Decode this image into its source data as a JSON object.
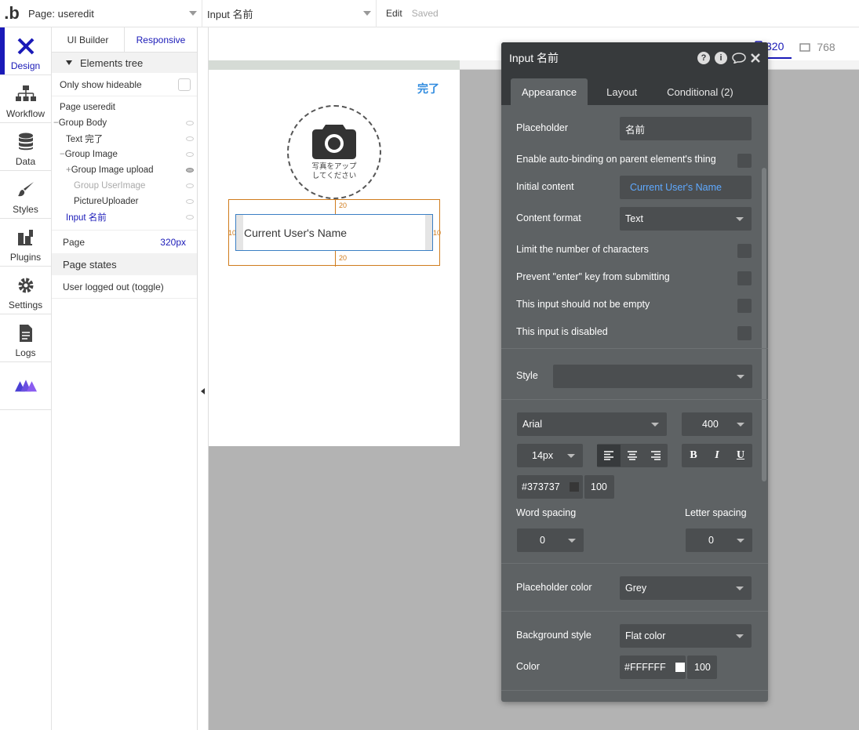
{
  "topbar": {
    "logo": ".b",
    "page_select": "Page: useredit",
    "element_select": "Input 名前",
    "edit": "Edit",
    "saved": "Saved"
  },
  "rail": {
    "items": [
      {
        "label": "Design",
        "icon": "design-icon"
      },
      {
        "label": "Workflow",
        "icon": "workflow-icon"
      },
      {
        "label": "Data",
        "icon": "data-icon"
      },
      {
        "label": "Styles",
        "icon": "styles-icon"
      },
      {
        "label": "Plugins",
        "icon": "plugins-icon"
      },
      {
        "label": "Settings",
        "icon": "settings-icon"
      },
      {
        "label": "Logs",
        "icon": "logs-icon"
      }
    ],
    "accent": "#1a1ab8"
  },
  "panel": {
    "tab_ui": "UI Builder",
    "tab_responsive": "Responsive",
    "elements_tree": "Elements tree",
    "only_show_hideable": "Only show hideable",
    "tree": [
      "Page useredit",
      "Group Body",
      "Text 完了",
      "Group Image",
      "Group Image upload",
      "Group UserImage",
      "PictureUploader",
      "Input 名前"
    ],
    "page_label": "Page",
    "page_value": "320px",
    "page_states": "Page states",
    "state_1": "User logged out (toggle)"
  },
  "canvas": {
    "done": "完了",
    "camera_text_1": "写真をアップ",
    "camera_text_2": "してください",
    "margin_top": "20",
    "margin_bottom": "20",
    "margin_left": "10",
    "margin_right": "10",
    "input_text": "Current User's Name",
    "resp_320": "320",
    "resp_768": "768"
  },
  "editor": {
    "title": "Input 名前",
    "tabs": [
      "Appearance",
      "Layout",
      "Conditional (2)"
    ],
    "placeholder_label": "Placeholder",
    "placeholder_value": "名前",
    "auto_binding": "Enable auto-binding on parent element's thing",
    "initial_content_label": "Initial content",
    "initial_content_value": "Current User's Name",
    "content_format_label": "Content format",
    "content_format_value": "Text",
    "limit_chars": "Limit the number of characters",
    "prevent_enter": "Prevent \"enter\" key from submitting",
    "not_empty": "This input should not be empty",
    "disabled": "This input is disabled",
    "style_label": "Style",
    "font": "Arial",
    "weight": "400",
    "size": "14px",
    "bold": "B",
    "italic": "I",
    "underline": "U",
    "font_color": "#373737",
    "font_opacity": "100",
    "word_spacing_label": "Word spacing",
    "word_spacing_value": "0",
    "letter_spacing_label": "Letter spacing",
    "letter_spacing_value": "0",
    "placeholder_color_label": "Placeholder color",
    "placeholder_color_value": "Grey",
    "bg_style_label": "Background style",
    "bg_style_value": "Flat color",
    "color_label": "Color",
    "color_value": "#FFFFFF",
    "color_opacity": "100"
  }
}
